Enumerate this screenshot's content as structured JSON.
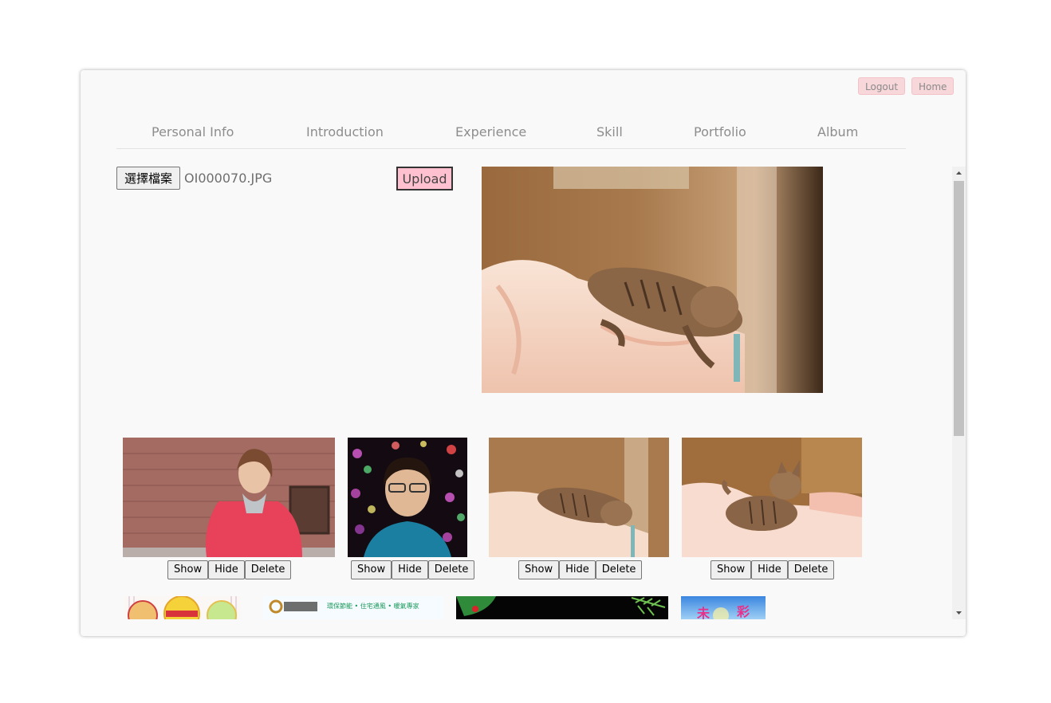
{
  "header": {
    "logout_label": "Logout",
    "home_label": "Home"
  },
  "nav": {
    "items": [
      {
        "label": "Personal Info"
      },
      {
        "label": "Introduction"
      },
      {
        "label": "Experience"
      },
      {
        "label": "Skill"
      },
      {
        "label": "Portfolio"
      },
      {
        "label": "Album"
      }
    ]
  },
  "upload": {
    "choose_file_label": "選擇檔案",
    "file_name": "OI000070.JPG",
    "upload_label": "Upload"
  },
  "gallery": {
    "buttons": {
      "show": "Show",
      "hide": "Hide",
      "delete": "Delete"
    }
  },
  "banners": {
    "banner2_text": "環保節能 • 住宅通風 • 暖氣專家",
    "banner4_text": "彩"
  },
  "colors": {
    "accent": "#ffc0d0",
    "topbtn_bg": "#f8d7da",
    "nav_text": "#8d8d8d"
  }
}
